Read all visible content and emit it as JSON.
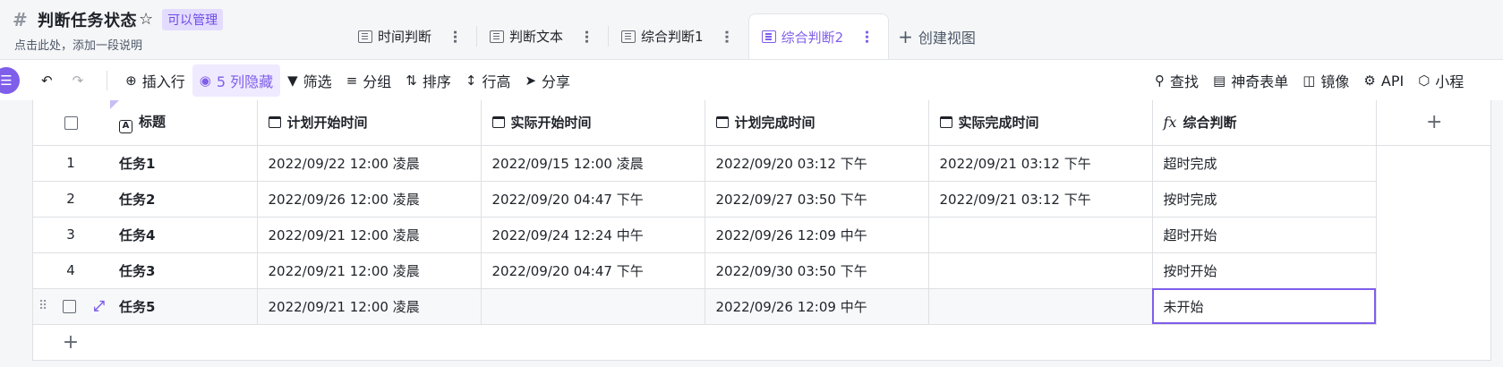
{
  "header": {
    "title": "判断任务状态",
    "permission": "可以管理",
    "description": "点击此处，添加一段说明",
    "tabs": [
      {
        "label": "时间判断",
        "active": false
      },
      {
        "label": "判断文本",
        "active": false
      },
      {
        "label": "综合判断1",
        "active": false
      },
      {
        "label": "综合判断2",
        "active": true
      }
    ],
    "create_view": "创建视图"
  },
  "toolbar": {
    "insert_row": "插入行",
    "hidden_cols": "5 列隐藏",
    "filter": "筛选",
    "group": "分组",
    "sort": "排序",
    "row_height": "行高",
    "share": "分享",
    "find": "查找",
    "magic_form": "神奇表单",
    "mirror": "镜像",
    "api": "API",
    "mini": "小程"
  },
  "table": {
    "columns": [
      {
        "label": "标题",
        "icon": "text-field-icon"
      },
      {
        "label": "计划开始时间",
        "icon": "calendar-icon"
      },
      {
        "label": "实际开始时间",
        "icon": "calendar-icon"
      },
      {
        "label": "计划完成时间",
        "icon": "calendar-icon"
      },
      {
        "label": "实际完成时间",
        "icon": "calendar-icon"
      },
      {
        "label": "综合判断",
        "icon": "formula-icon"
      }
    ],
    "rows": [
      {
        "idx": "1",
        "cells": [
          "任务1",
          "2022/09/22 12:00 凌晨",
          "2022/09/15 12:00 凌晨",
          "2022/09/20 03:12 下午",
          "2022/09/21 03:12 下午",
          "超时完成"
        ]
      },
      {
        "idx": "2",
        "cells": [
          "任务2",
          "2022/09/26 12:00 凌晨",
          "2022/09/20 04:47 下午",
          "2022/09/27 03:50 下午",
          "2022/09/21 03:12 下午",
          "按时完成"
        ]
      },
      {
        "idx": "3",
        "cells": [
          "任务4",
          "2022/09/21 12:00 凌晨",
          "2022/09/24 12:24 中午",
          "2022/09/26 12:09 中午",
          "",
          "超时开始"
        ]
      },
      {
        "idx": "4",
        "cells": [
          "任务3",
          "2022/09/21 12:00 凌晨",
          "2022/09/20 04:47 下午",
          "2022/09/30 03:50 下午",
          "",
          "按时开始"
        ]
      },
      {
        "idx": "",
        "cells": [
          "任务5",
          "2022/09/21 12:00 凌晨",
          "",
          "2022/09/26 12:09 中午",
          "",
          "未开始"
        ]
      }
    ]
  },
  "colors": {
    "accent": "#7f5eea",
    "accent_bg": "#efeaff"
  }
}
